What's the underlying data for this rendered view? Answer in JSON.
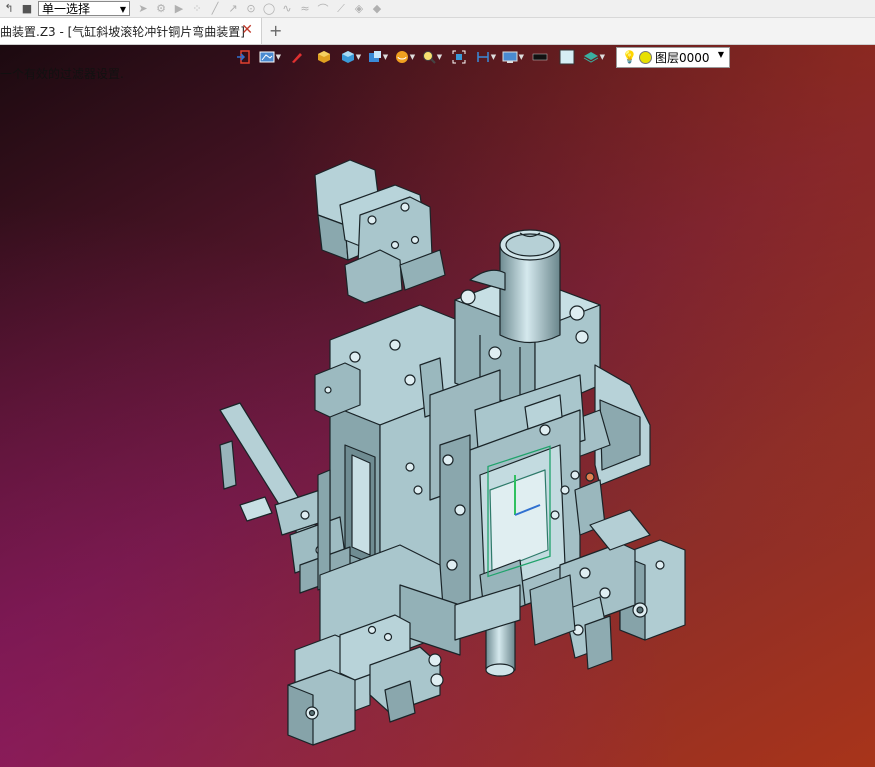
{
  "toolbar": {
    "selection_mode": "单一选择"
  },
  "tab": {
    "label": "曲装置.Z3 - [气缸斜坡滚轮冲针铜片弯曲装置]",
    "close_symbol": "✕",
    "add_symbol": "+"
  },
  "viewport": {
    "status_message": "一个有效的过滤器设置."
  },
  "layer": {
    "label": "图层0000"
  },
  "colors": {
    "part": "#a9c6cc",
    "edge": "#1a2428",
    "bg_dark": "#1c0a10",
    "bg_orange": "#a8341a",
    "bg_magenta": "#8c1464"
  }
}
